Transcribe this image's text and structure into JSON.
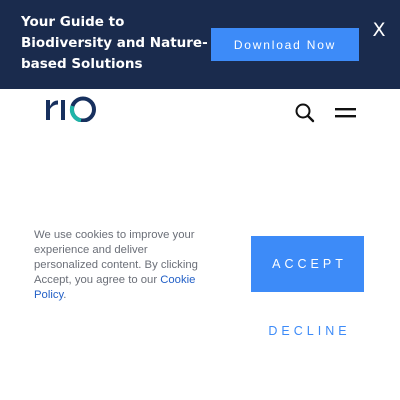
{
  "promo_banner": {
    "text": "Your Guide to Biodiversity and Nature-based Solutions",
    "download_label": "Download Now",
    "close_label": "X"
  },
  "header": {
    "logo_text": "rio",
    "search_icon": "search-icon",
    "menu_icon": "hamburger-menu-icon"
  },
  "cookie_banner": {
    "message": "We use cookies to improve your experience and deliver personalized content. By clicking Accept, you agree to our ",
    "link_label": "Cookie Policy",
    "message_end": ".",
    "accept_label": "ACCEPT",
    "decline_label": "DECLINE"
  },
  "colors": {
    "banner_bg": "#1a2b4d",
    "accent_blue": "#3d8bf8",
    "link_blue": "#2461c7",
    "logo_navy": "#17305e",
    "logo_teal": "#1fb5a8",
    "body_text": "#6b6f78"
  }
}
